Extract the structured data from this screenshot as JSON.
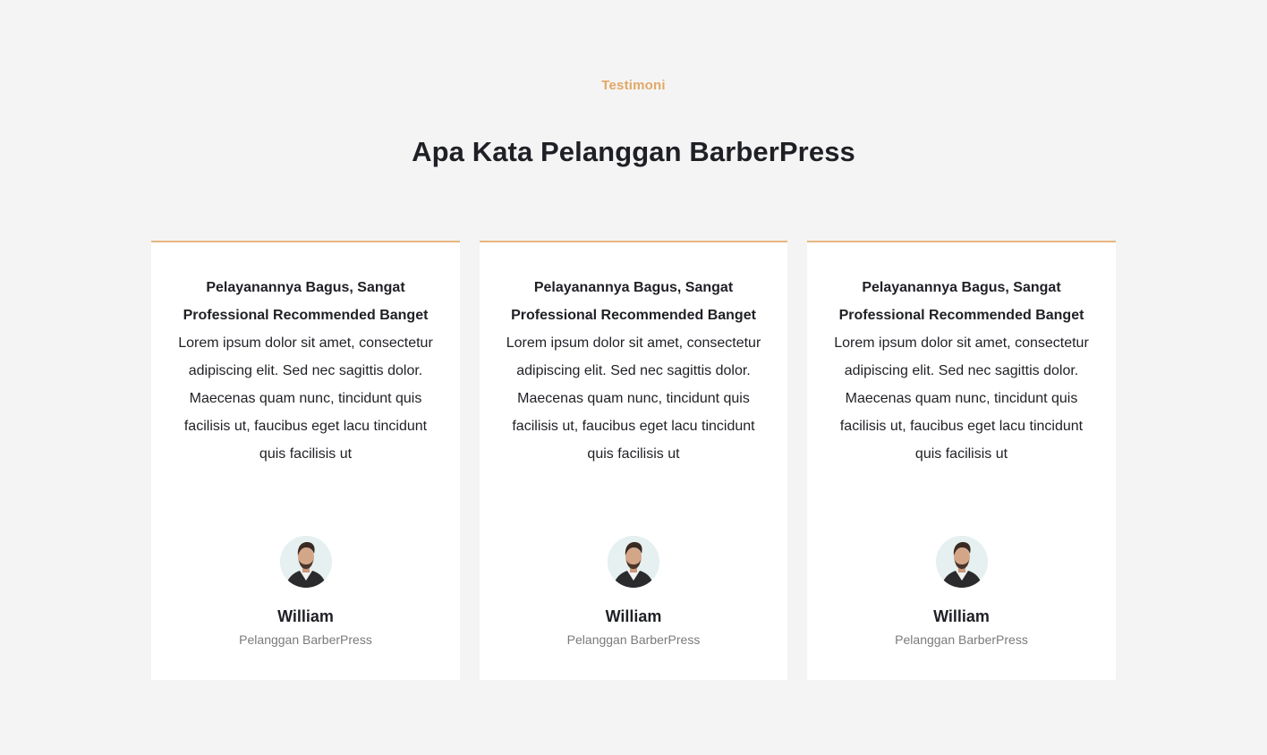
{
  "section": {
    "eyebrow": "Testimoni",
    "title": "Apa Kata Pelanggan BarberPress"
  },
  "testimonials": [
    {
      "headline": "Pelayanannya Bagus, Sangat Professional Recommended Banget",
      "body": "Lorem ipsum dolor sit amet, consectetur adipiscing elit. Sed nec sagittis dolor. Maecenas quam nunc, tincidunt quis facilisis ut, faucibus eget lacu tincidunt quis facilisis ut",
      "name": "William",
      "role": "Pelanggan BarberPress",
      "avatar_icon": "man-portrait-avatar"
    },
    {
      "headline": "Pelayanannya Bagus, Sangat Professional Recommended Banget",
      "body": "Lorem ipsum dolor sit amet, consectetur adipiscing elit. Sed nec sagittis dolor. Maecenas quam nunc, tincidunt quis facilisis ut, faucibus eget lacu tincidunt quis facilisis ut",
      "name": "William",
      "role": "Pelanggan BarberPress",
      "avatar_icon": "man-portrait-avatar"
    },
    {
      "headline": "Pelayanannya Bagus, Sangat Professional Recommended Banget",
      "body": "Lorem ipsum dolor sit amet, consectetur adipiscing elit. Sed nec sagittis dolor. Maecenas quam nunc, tincidunt quis facilisis ut, faucibus eget lacu tincidunt quis facilisis ut",
      "name": "William",
      "role": "Pelanggan BarberPress",
      "avatar_icon": "man-portrait-avatar"
    }
  ],
  "colors": {
    "accent": "#e2a866",
    "card_border": "#e6b67f",
    "background": "#f4f4f4",
    "card_background": "#ffffff",
    "heading": "#1f2025",
    "muted": "#7a7a7a"
  }
}
